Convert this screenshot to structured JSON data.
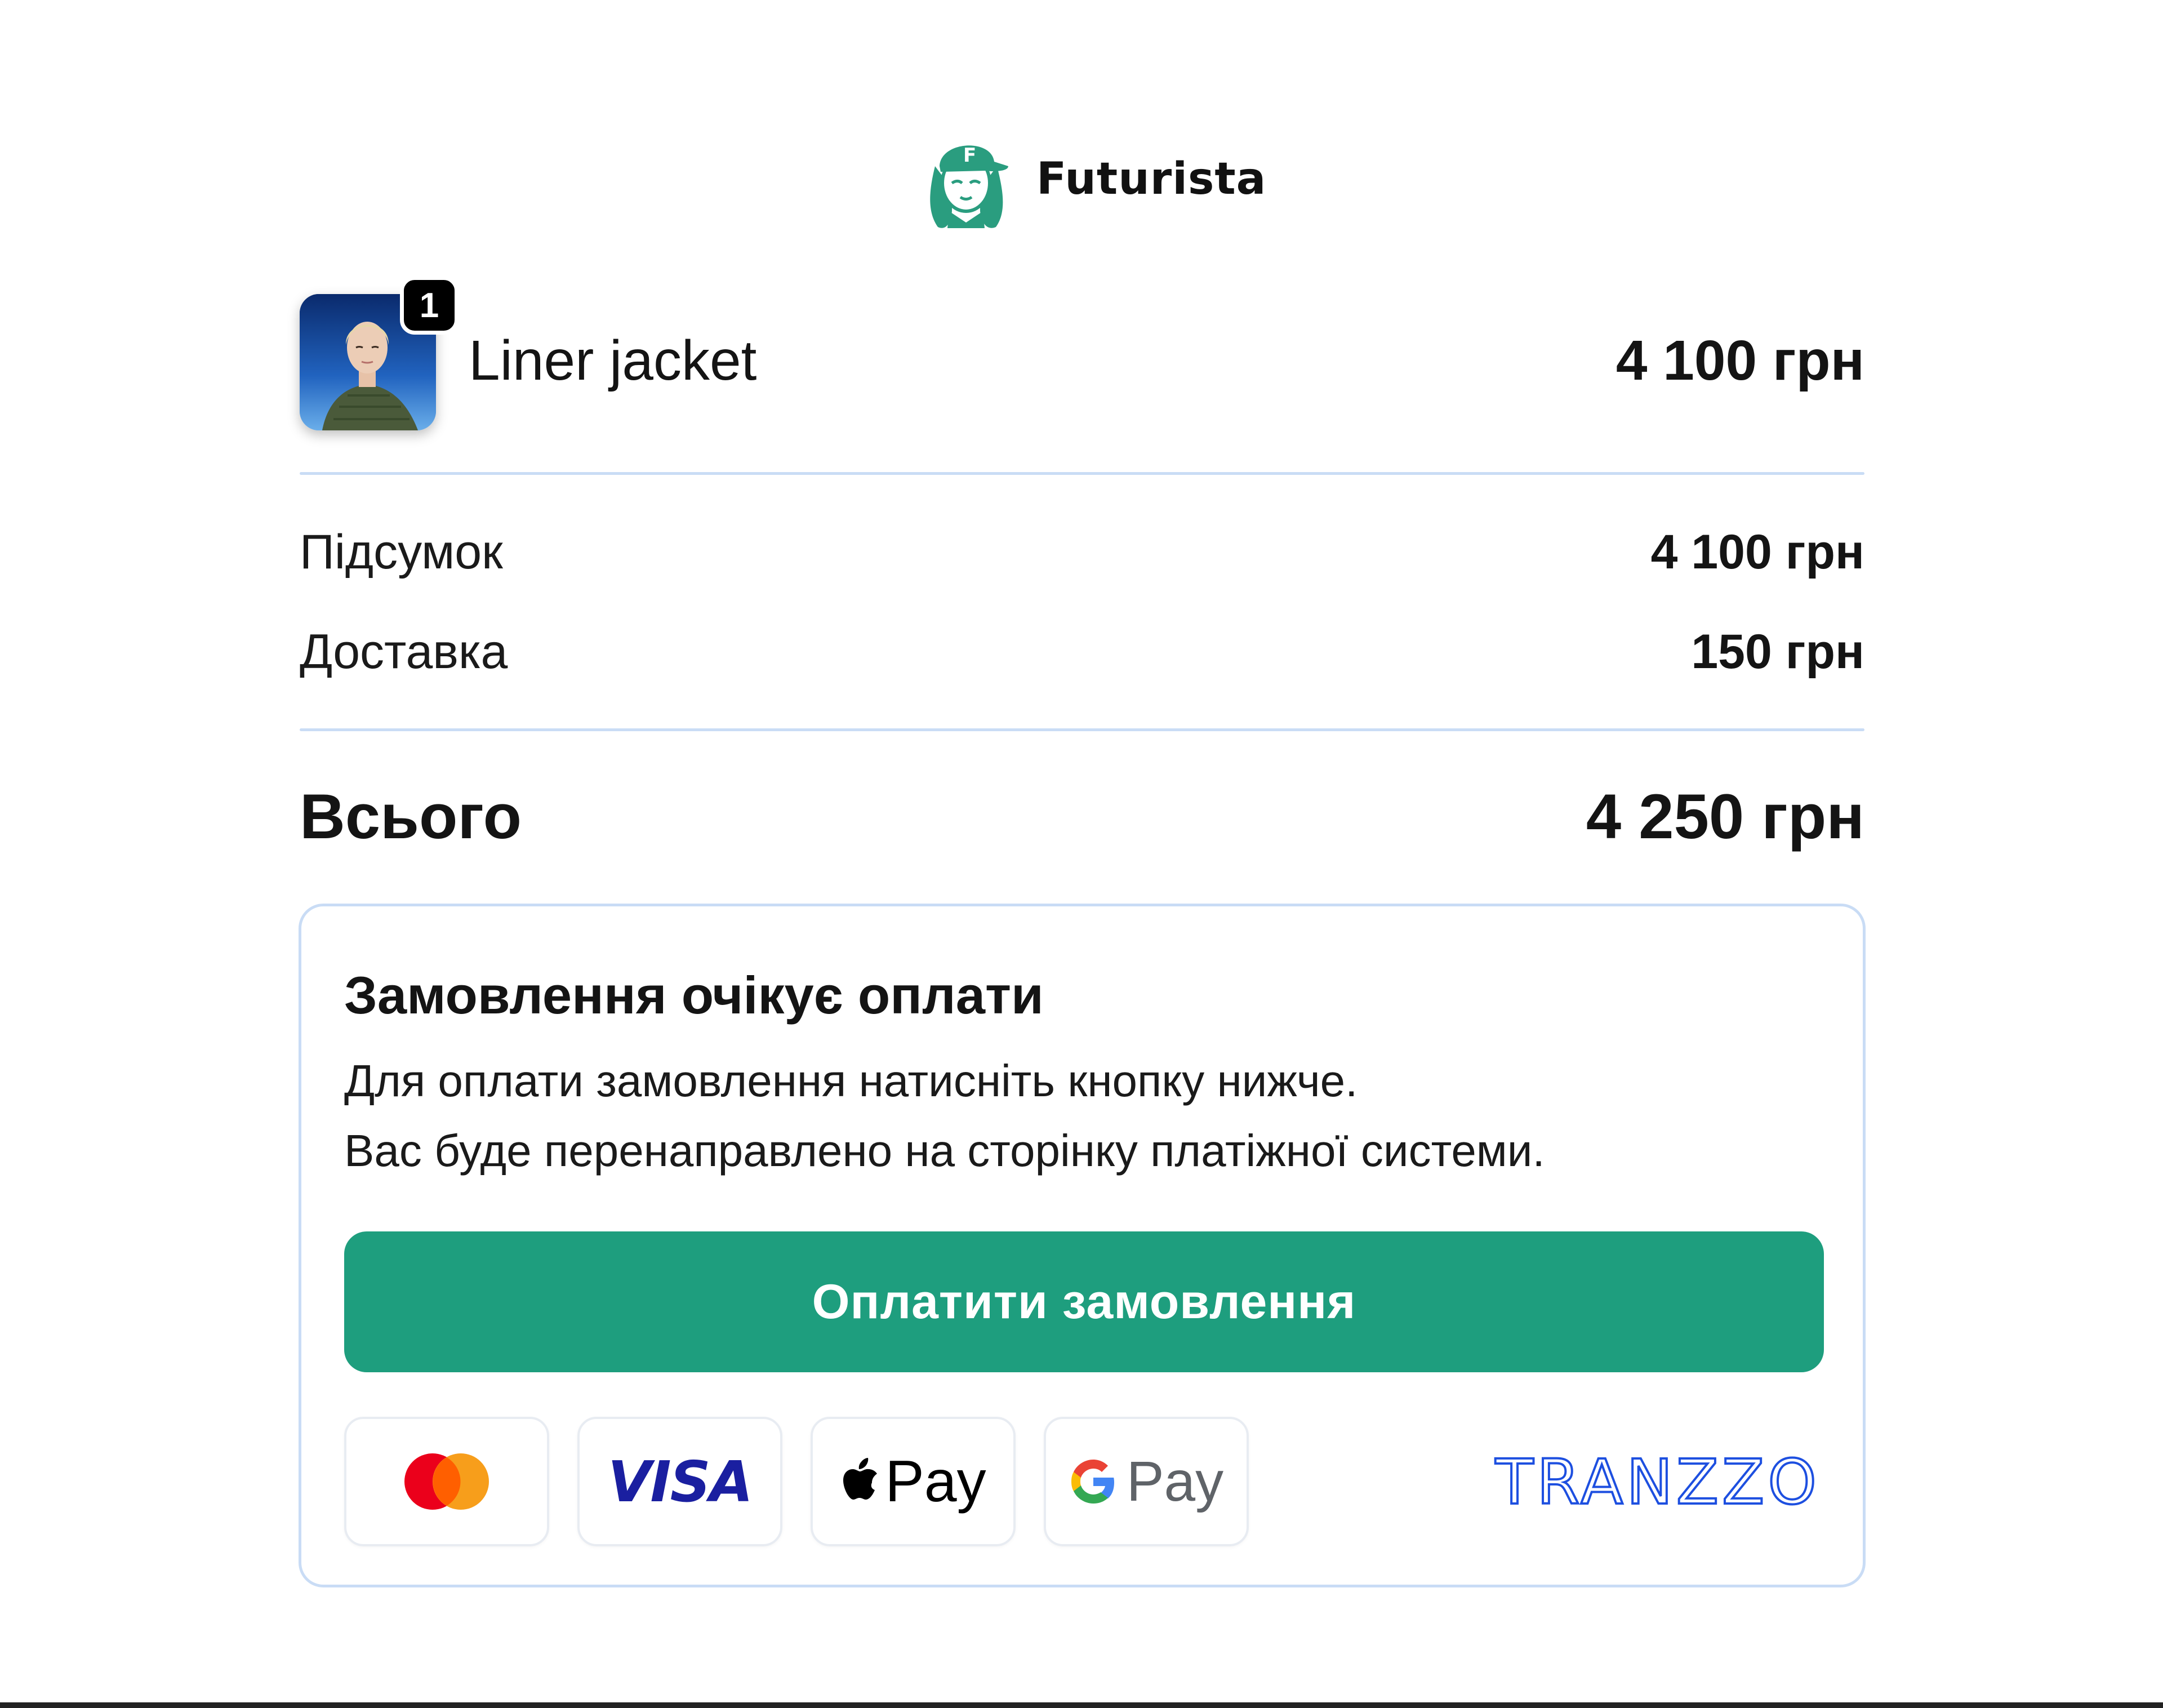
{
  "brand": {
    "name": "Futurista",
    "color": "#2a9d7f"
  },
  "product": {
    "quantity": "1",
    "name": "Liner jacket",
    "price": "4 100 грн"
  },
  "summary": {
    "subtotal_label": "Підсумок",
    "subtotal_value": "4 100 грн",
    "delivery_label": "Доставка",
    "delivery_value": "150 грн",
    "total_label": "Всього",
    "total_value": "4 250 грн"
  },
  "payment": {
    "title": "Замовлення очікує оплати",
    "line1": "Для оплати замовлення натисніть кнопку нижче.",
    "line2": "Вас буде перенаправлено на сторінку платіжної системи.",
    "button_label": "Оплатити замовлення",
    "button_color": "#1e9e7e",
    "methods": {
      "mastercard": "mastercard-icon",
      "visa": "VISA",
      "applepay": "Pay",
      "googlepay": "Pay"
    },
    "provider": "TRANZZO",
    "provider_color": "#1d4fe0"
  }
}
